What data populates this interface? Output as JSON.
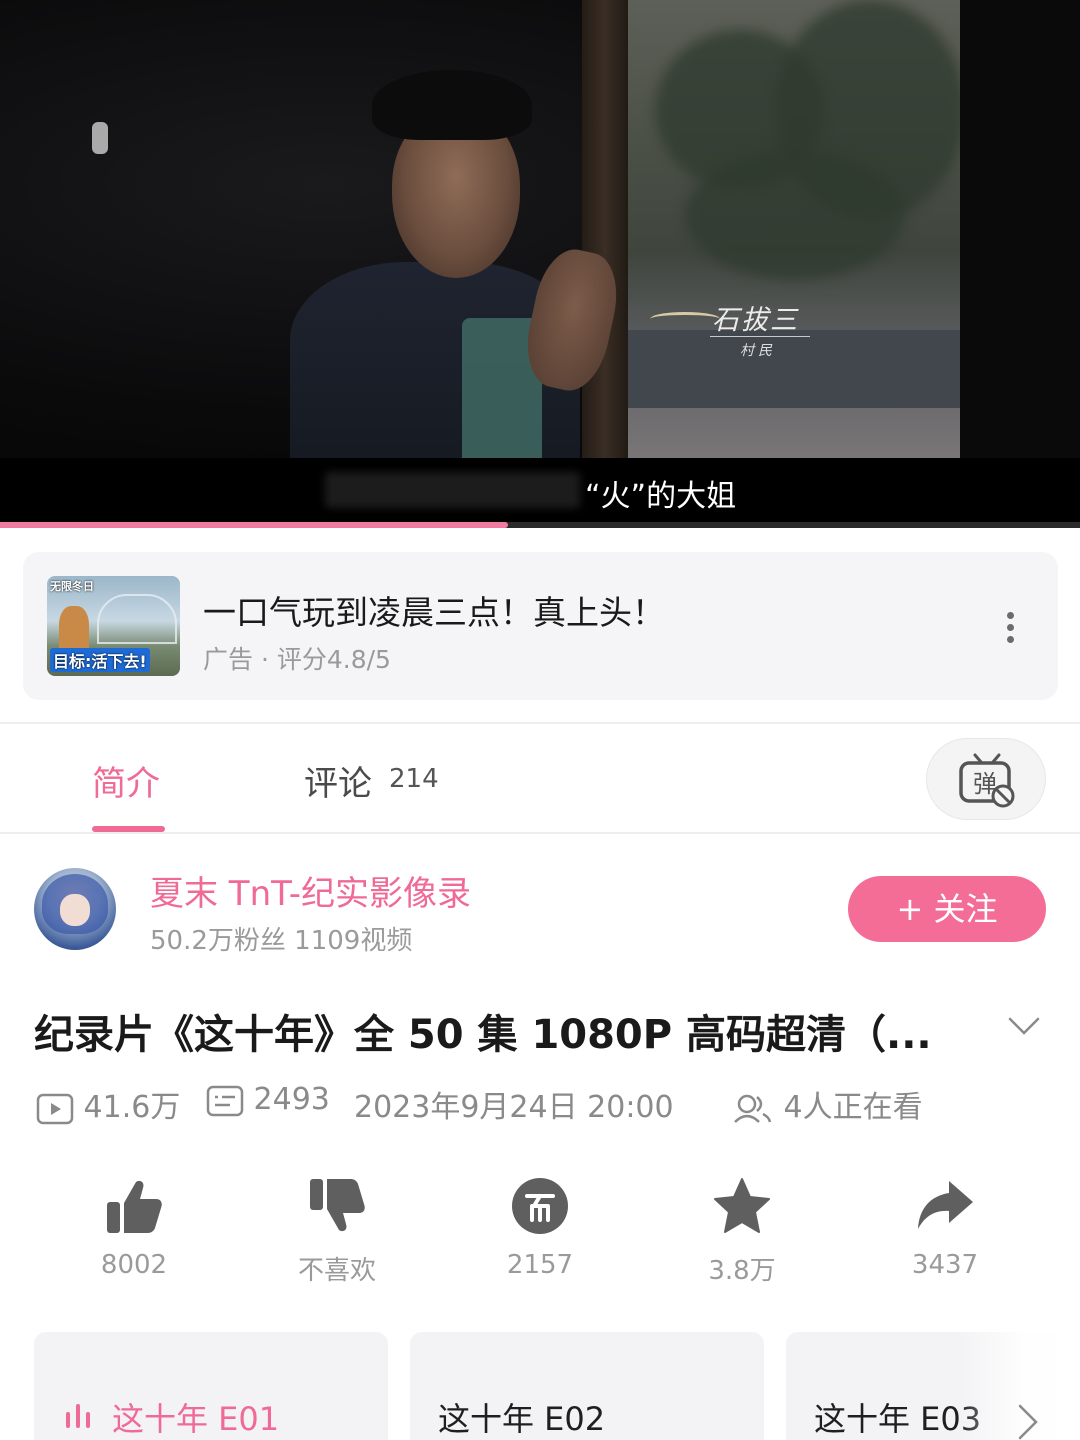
{
  "player": {
    "person_caption": {
      "name": "石拔三",
      "role": "村民"
    },
    "subtitle": "“火”的大姐",
    "progress_fraction": 0.47
  },
  "ad": {
    "thumb_text_top": "无限冬日",
    "thumb_text_bottom": "目标:活下去!",
    "title": "一口气玩到凌晨三点！真上头！",
    "subtitle": "广告 · 评分4.8/5",
    "more_icon": "more-vertical-icon"
  },
  "tabs": {
    "intro": "简介",
    "comments": "评论",
    "comments_count": "214",
    "danmaku_icon": "danmaku-off-icon"
  },
  "uploader": {
    "name": "夏末 TnT-纪实影像录",
    "stats": "50.2万粉丝   1109视频",
    "follow_label": "+ 关注"
  },
  "video": {
    "title": "纪录片《这十年》全 50 集 1080P 高码超清（...",
    "views": "41.6万",
    "danmaku_count": "2493",
    "published": "2023年9月24日 20:00",
    "watching": "4人正在看"
  },
  "actions": [
    {
      "icon": "thumbs-up-icon",
      "label": "8002"
    },
    {
      "icon": "thumbs-down-icon",
      "label": "不喜欢"
    },
    {
      "icon": "coin-icon",
      "label": "2157"
    },
    {
      "icon": "star-icon",
      "label": "3.8万"
    },
    {
      "icon": "share-icon",
      "label": "3437"
    }
  ],
  "episodes": [
    {
      "title": "这十年 E01",
      "active": true
    },
    {
      "title": "这十年 E02",
      "active": false
    },
    {
      "title": "这十年 E03",
      "active": false
    }
  ],
  "colors": {
    "accent": "#f06a96",
    "follow_button": "#f46d96",
    "muted_text": "#9a9a9a",
    "icon_gray": "#5f5f5f"
  }
}
